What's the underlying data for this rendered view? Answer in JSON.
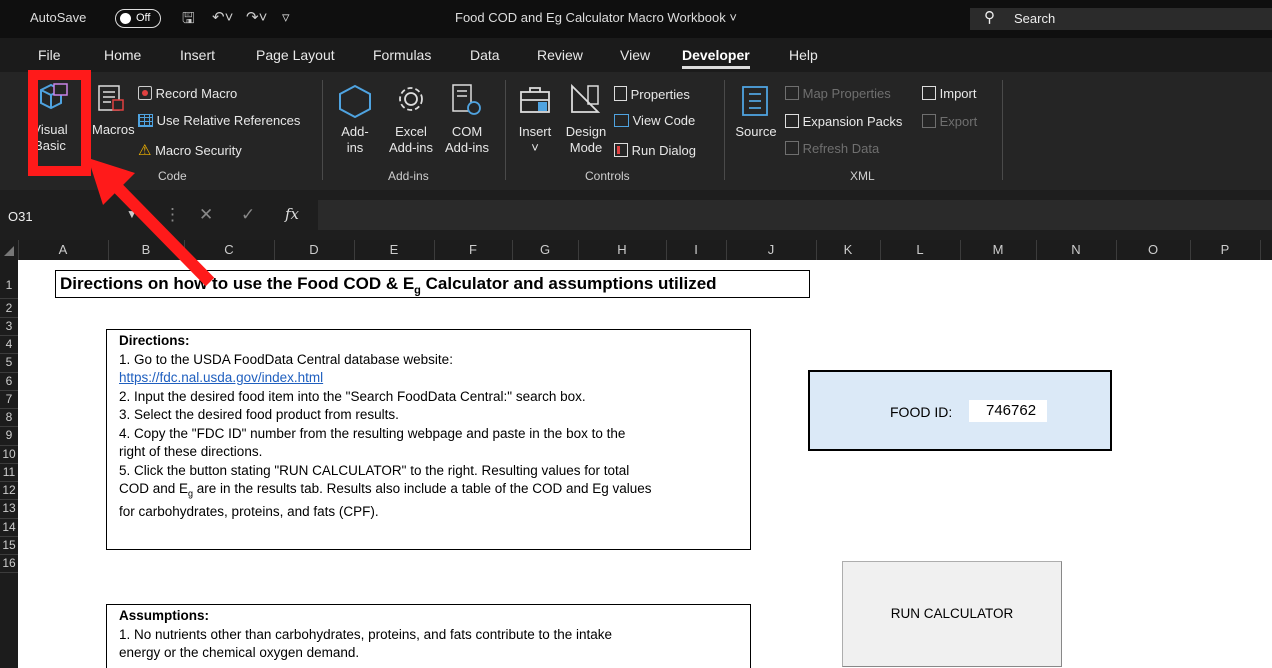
{
  "titlebar": {
    "autosave_label": "AutoSave",
    "autosave_toggle": "Off",
    "document_title": "Food COD and Eg Calculator Macro Workbook",
    "search_label": "Search"
  },
  "menu": {
    "tabs": [
      "File",
      "Home",
      "Insert",
      "Page Layout",
      "Formulas",
      "Data",
      "Review",
      "View",
      "Developer",
      "Help"
    ],
    "active": "Developer"
  },
  "ribbon": {
    "code": {
      "visual_basic_line1": "Visual",
      "visual_basic_line2": "Basic",
      "macros": "Macros",
      "record_macro": "Record Macro",
      "use_relative": "Use Relative References",
      "macro_security": "Macro Security",
      "label": "Code"
    },
    "addins": {
      "addins_line1": "Add-",
      "addins_line2": "ins",
      "excel_line1": "Excel",
      "excel_line2": "Add-ins",
      "com_line1": "COM",
      "com_line2": "Add-ins",
      "label": "Add-ins"
    },
    "controls": {
      "insert": "Insert",
      "design_line1": "Design",
      "design_line2": "Mode",
      "properties": "Properties",
      "view_code": "View Code",
      "run_dialog": "Run Dialog",
      "label": "Controls"
    },
    "xml": {
      "source": "Source",
      "map_properties": "Map Properties",
      "expansion_packs": "Expansion Packs",
      "refresh_data": "Refresh Data",
      "import": "Import",
      "export": "Export",
      "label": "XML"
    }
  },
  "formula_bar": {
    "name_box": "O31",
    "fx": "fx"
  },
  "columns": [
    "A",
    "B",
    "C",
    "D",
    "E",
    "F",
    "G",
    "H",
    "I",
    "J",
    "K",
    "L",
    "M",
    "N",
    "O",
    "P"
  ],
  "rows": [
    "1",
    "2",
    "3",
    "4",
    "5",
    "6",
    "7",
    "8",
    "9",
    "10",
    "11",
    "12",
    "13",
    "14",
    "15",
    "16"
  ],
  "sheet": {
    "title_part1": "Directions on how to use the Food COD & E",
    "title_sub": "g",
    "title_part2": " Calculator and assumptions utilized",
    "directions": {
      "heading": "Directions:",
      "line1": "1. Go to the USDA FoodData Central database website:",
      "link": "https://fdc.nal.usda.gov/index.html",
      "line2": "2. Input the desired food item into the \"Search FoodData Central:\" search box.",
      "line3": "3. Select the desired food product from results.",
      "line4a": "4. Copy the \"FDC ID\" number from the resulting webpage and paste in the box to the",
      "line4b": "right of these directions.",
      "line5a": "5. Click the button stating \"RUN CALCULATOR\" to the right. Resulting values for total",
      "line5b_pre": "COD and E",
      "line5b_sub": "g",
      "line5b_post": " are in the results tab. Results also include a table of the COD and Eg values",
      "line5c": "for carbohydrates, proteins, and fats (CPF)."
    },
    "food_id": {
      "label": "FOOD ID:",
      "value": "746762"
    },
    "run_button": "RUN CALCULATOR",
    "assumptions": {
      "heading": "Assumptions:",
      "line1": "1. No nutrients other than carbohydrates, proteins, and fats contribute to the intake",
      "line2": "energy or the chemical oxygen demand."
    }
  },
  "colors": {
    "annotation_red": "#ff1a1a",
    "food_box_bg": "#dbe9f7",
    "ribbon_bg": "#252525"
  }
}
